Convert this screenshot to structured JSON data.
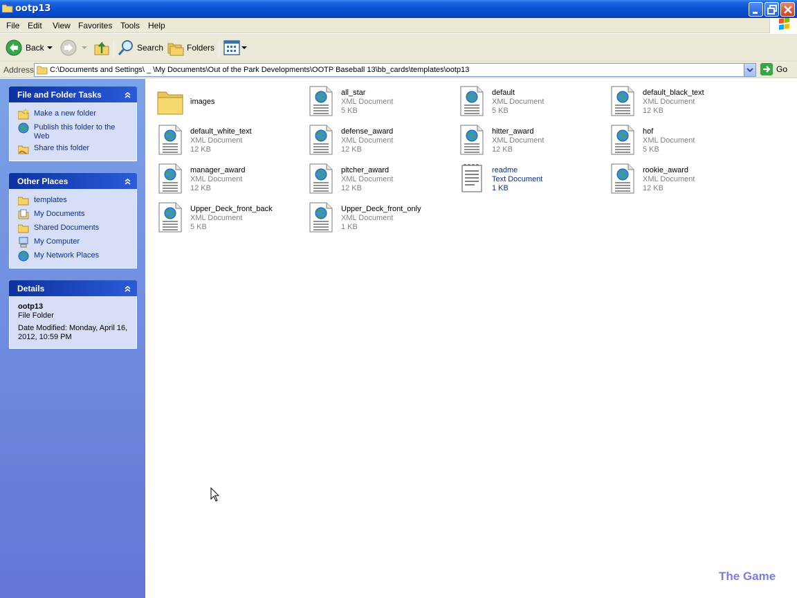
{
  "window": {
    "title": "ootp13",
    "icon": "folder-icon"
  },
  "menu": [
    "File",
    "Edit",
    "View",
    "Favorites",
    "Tools",
    "Help"
  ],
  "toolbar": {
    "back_label": "Back",
    "search_label": "Search",
    "folders_label": "Folders"
  },
  "address": {
    "label": "Address",
    "path": "C:\\Documents and Settings\\  _                              \\My Documents\\Out of the Park Developments\\OOTP Baseball 13\\bb_cards\\templates\\ootp13",
    "go_label": "Go"
  },
  "taskpane": {
    "file_tasks": {
      "title": "File and Folder Tasks",
      "items": [
        {
          "label": "Make a new folder",
          "icon": "new-folder-icon"
        },
        {
          "label": "Publish this folder to the Web",
          "icon": "publish-web-icon"
        },
        {
          "label": "Share this folder",
          "icon": "share-folder-icon"
        }
      ]
    },
    "other_places": {
      "title": "Other Places",
      "items": [
        {
          "label": "templates",
          "icon": "folder-icon"
        },
        {
          "label": "My Documents",
          "icon": "my-documents-icon"
        },
        {
          "label": "Shared Documents",
          "icon": "shared-documents-icon"
        },
        {
          "label": "My Computer",
          "icon": "my-computer-icon"
        },
        {
          "label": "My Network Places",
          "icon": "network-places-icon"
        }
      ]
    },
    "details": {
      "title": "Details",
      "name": "ootp13",
      "type": "File Folder",
      "modified": "Date Modified: Monday, April 16, 2012, 10:59 PM"
    }
  },
  "files": [
    {
      "name": "images",
      "type": "",
      "size": "",
      "kind": "folder"
    },
    {
      "name": "all_star",
      "type": "XML Document",
      "size": "5 KB",
      "kind": "xml"
    },
    {
      "name": "default",
      "type": "XML Document",
      "size": "5 KB",
      "kind": "xml"
    },
    {
      "name": "default_black_text",
      "type": "XML Document",
      "size": "12 KB",
      "kind": "xml"
    },
    {
      "name": "default_white_text",
      "type": "XML Document",
      "size": "12 KB",
      "kind": "xml"
    },
    {
      "name": "defense_award",
      "type": "XML Document",
      "size": "12 KB",
      "kind": "xml"
    },
    {
      "name": "hitter_award",
      "type": "XML Document",
      "size": "12 KB",
      "kind": "xml"
    },
    {
      "name": "hof",
      "type": "XML Document",
      "size": "5 KB",
      "kind": "xml"
    },
    {
      "name": "manager_award",
      "type": "XML Document",
      "size": "12 KB",
      "kind": "xml"
    },
    {
      "name": "pitcher_award",
      "type": "XML Document",
      "size": "12 KB",
      "kind": "xml"
    },
    {
      "name": "readme",
      "type": "Text Document",
      "size": "1 KB",
      "kind": "text"
    },
    {
      "name": "rookie_award",
      "type": "XML Document",
      "size": "12 KB",
      "kind": "xml"
    },
    {
      "name": "Upper_Deck_front_back",
      "type": "XML Document",
      "size": "5 KB",
      "kind": "xml"
    },
    {
      "name": "Upper_Deck_front_only",
      "type": "XML Document",
      "size": "1 KB",
      "kind": "xml"
    }
  ],
  "watermark": "The Game"
}
